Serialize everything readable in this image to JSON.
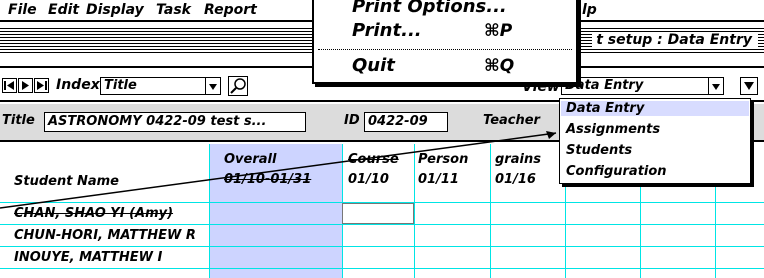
{
  "menubar": {
    "items": [
      "File",
      "Edit",
      "Display",
      "Task",
      "Report",
      "lp"
    ]
  },
  "file_menu": {
    "items": [
      {
        "label": "Print Options...",
        "shortcut": ""
      },
      {
        "label": "Print...",
        "shortcut": "⌘P"
      },
      {
        "label": "Quit",
        "shortcut": "⌘Q"
      }
    ]
  },
  "window": {
    "title": "t setup : Data Entry"
  },
  "toolbar": {
    "index_label": "Index",
    "index_value": "Title",
    "view_label": "View",
    "view_value": "Data Entry"
  },
  "view_menu": {
    "options": [
      "Data Entry",
      "Assignments",
      "Students",
      "Configuration"
    ],
    "selected": "Data Entry"
  },
  "info": {
    "title_label": "Title",
    "title_value": "ASTRONOMY 0422-09 test s...",
    "id_label": "ID",
    "id_value": "0422-09",
    "teacher_label": "Teacher"
  },
  "grid": {
    "columns": [
      {
        "line1": "",
        "line2": "Student Name"
      },
      {
        "line1": "Overall",
        "line2": "01/10-01/31"
      },
      {
        "line1": "Course",
        "line2": "01/10"
      },
      {
        "line1": "Person",
        "line2": "01/11"
      },
      {
        "line1": "grains",
        "line2": "01/16"
      }
    ],
    "students": [
      "CHAN, SHAO YI (Amy)",
      "CHUN-HORI, MATTHEW R",
      "INOUYE, MATTHEW I"
    ]
  },
  "colors": {
    "grid_line": "#00e5e5",
    "overall_fill": "#cdd4ff",
    "selection_fill": "#d8dcff",
    "info_bg": "#dcdcdc"
  }
}
